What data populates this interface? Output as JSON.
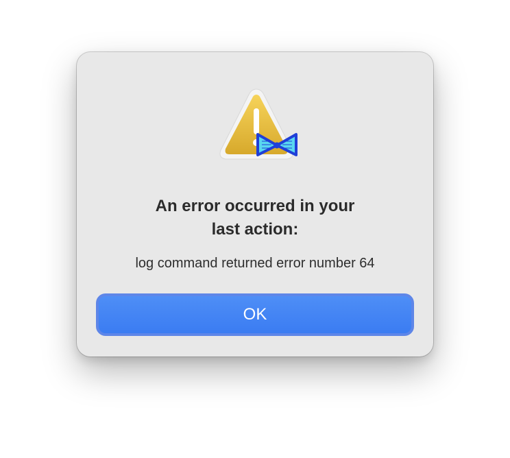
{
  "dialog": {
    "icon": "warning-triangle-icon",
    "badge_icon": "bowtie-app-icon",
    "title_lines": [
      "An error occurred in your",
      "last action:"
    ],
    "message": "log command returned error number 64",
    "ok_label": "OK"
  },
  "colors": {
    "dialog_background": "#e8e8e8",
    "button_blue": "#3f80f4",
    "warning_yellow": "#e2b93a",
    "badge_cyan": "#59d7f0",
    "badge_blue": "#1f3fd8"
  }
}
